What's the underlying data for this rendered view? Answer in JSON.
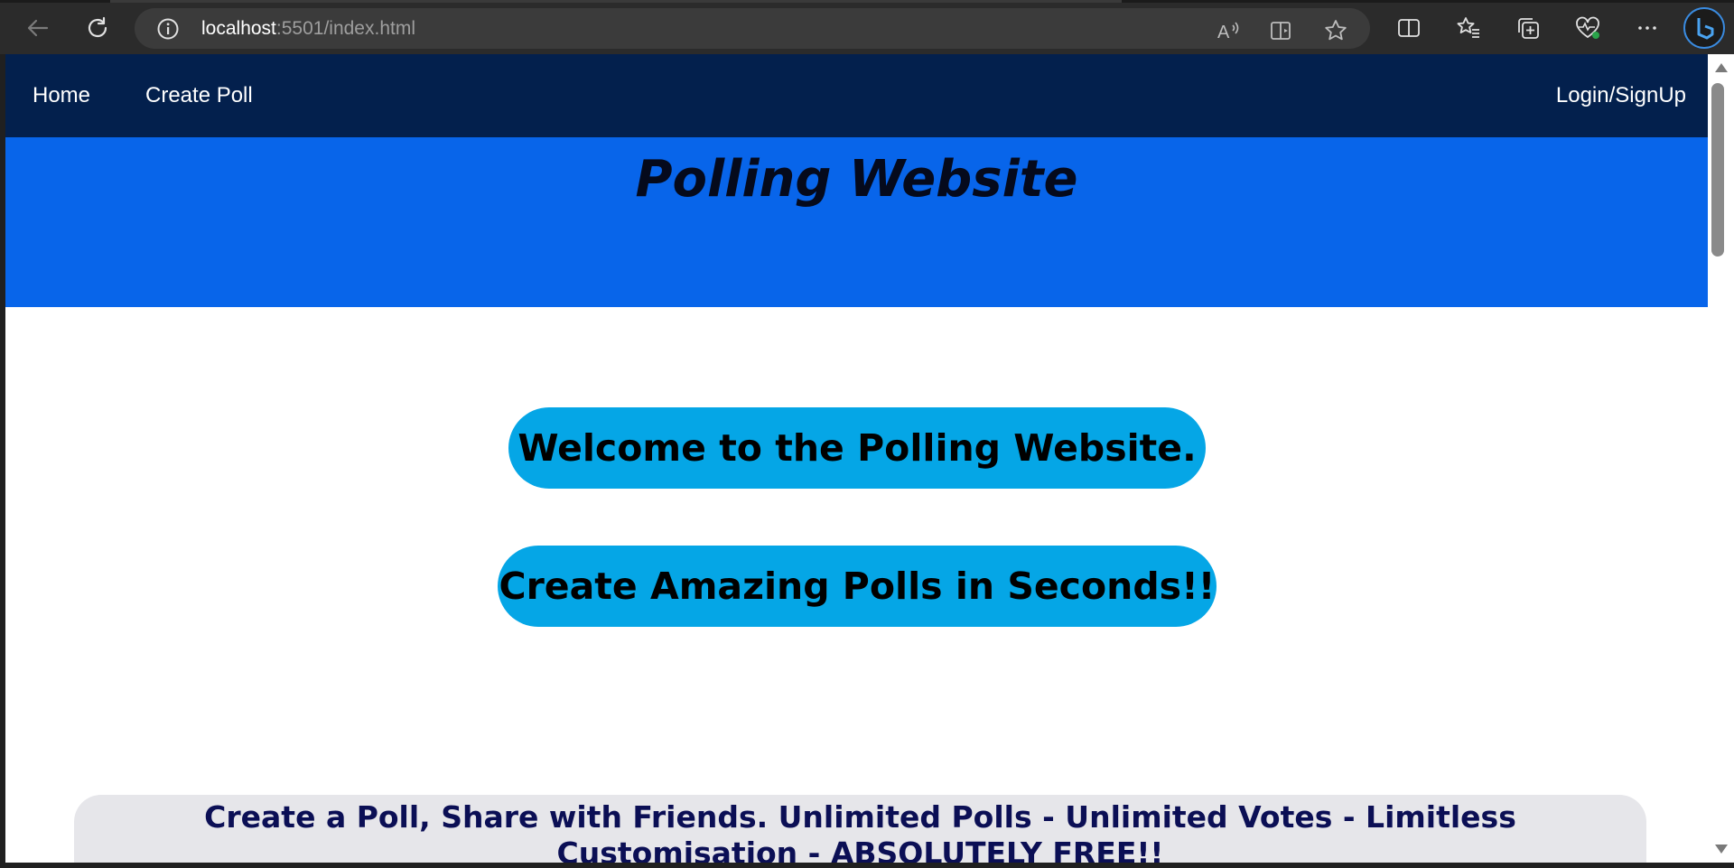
{
  "browser": {
    "url_host": "localhost",
    "url_rest": ":5501/index.html",
    "icons": {
      "back": "back-arrow-icon",
      "refresh": "refresh-icon",
      "info": "info-icon",
      "read_aloud": "read-aloud-icon",
      "immersive_reader": "immersive-reader-icon",
      "favorite": "star-icon",
      "split_screen": "split-screen-icon",
      "favorites": "favorites-icon",
      "collections": "collections-icon",
      "health": "browser-essentials-icon",
      "more": "more-icon",
      "copilot": "copilot-icon"
    }
  },
  "nav": {
    "home": "Home",
    "create_poll": "Create Poll",
    "login": "Login/SignUp"
  },
  "hero": {
    "title": "Polling Website"
  },
  "main": {
    "welcome": "Welcome to the Polling Website.",
    "tagline": "Create Amazing Polls in Seconds!!",
    "banner": "Create a Poll, Share with Friends. Unlimited Polls - Unlimited Votes - Limitless Customisation - ABSOLUTELY FREE!!"
  },
  "colors": {
    "navbar": "#03204d",
    "hero": "#0865ea",
    "pill": "#05a6e6",
    "banner_bg": "#e6e6ea",
    "banner_text": "#0b0f55"
  }
}
